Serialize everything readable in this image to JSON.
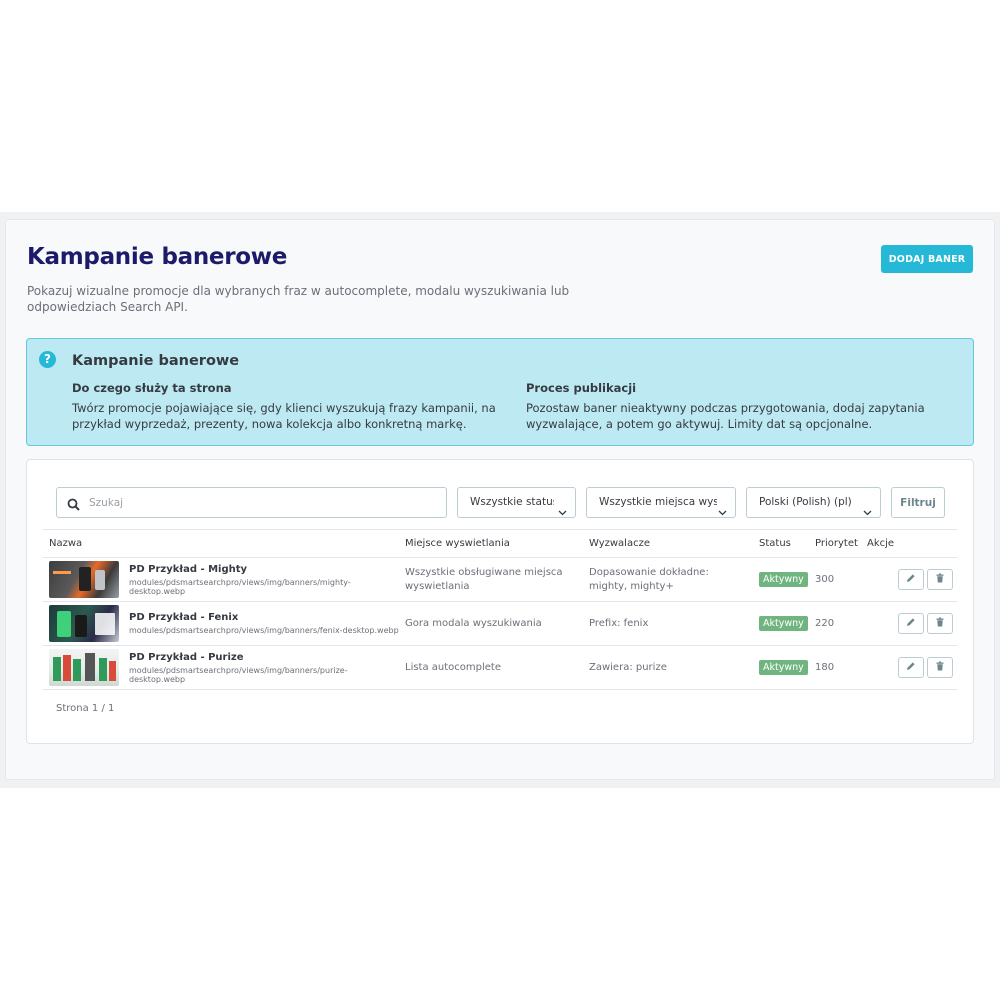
{
  "header": {
    "title": "Kampanie banerowe",
    "description": "Pokazuj wizualne promocje dla wybranych fraz w autocomplete, modalu wyszukiwania lub odpowiedziach Search API.",
    "add_button": "DODAJ BANER"
  },
  "info": {
    "title": "Kampanie banerowe",
    "col1_heading": "Do czego służy ta strona",
    "col1_text": "Twórz promocje pojawiające się, gdy klienci wyszukują frazy kampanii, na przykład wyprzedaż, prezenty, nowa kolekcja albo konkretną markę.",
    "col2_heading": "Proces publikacji",
    "col2_text": "Pozostaw baner nieaktywny podczas przygotowania, dodaj zapytania wyzwalające, a potem go aktywuj. Limity dat są opcjonalne."
  },
  "filters": {
    "search_placeholder": "Szukaj",
    "status": "Wszystkie statusy",
    "placement": "Wszystkie miejsca wyswietlania",
    "language": "Polski (Polish) (pl)",
    "filter_button": "Filtruj"
  },
  "table": {
    "headers": [
      "Nazwa",
      "Miejsce wyswietlania",
      "Wyzwalacze",
      "Status",
      "Priorytet",
      "Akcje"
    ],
    "rows": [
      {
        "name": "PD Przykład - Mighty",
        "path": "modules/pdsmartsearchpro/views/img/banners/mighty-desktop.webp",
        "placement": "Wszystkie obsługiwane miejsca wyswietlania",
        "triggers": "Dopasowanie dokładne: mighty, mighty+",
        "status": "Aktywny",
        "priority": "300"
      },
      {
        "name": "PD Przykład - Fenix",
        "path": "modules/pdsmartsearchpro/views/img/banners/fenix-desktop.webp",
        "placement": "Gora modala wyszukiwania",
        "triggers": "Prefix: fenix",
        "status": "Aktywny",
        "priority": "220"
      },
      {
        "name": "PD Przykład - Purize",
        "path": "modules/pdsmartsearchpro/views/img/banners/purize-desktop.webp",
        "placement": "Lista autocomplete",
        "triggers": "Zawiera: purize",
        "status": "Aktywny",
        "priority": "180"
      }
    ]
  },
  "pager": "Strona 1 / 1",
  "colors": {
    "title": "#1d1a6b",
    "accent": "#25b9d7",
    "info_bg": "#bdeaf2",
    "status_active": "#70b580"
  }
}
